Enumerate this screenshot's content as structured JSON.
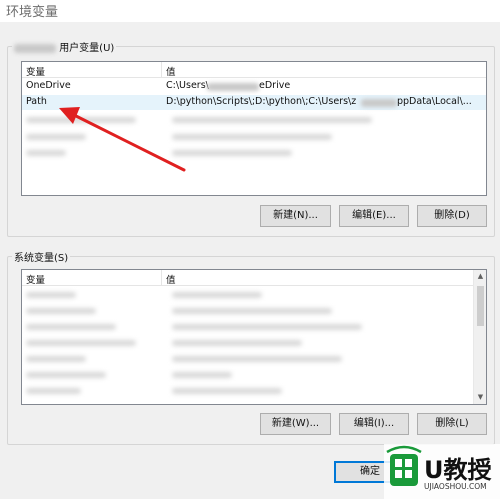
{
  "window": {
    "title": "环境变量"
  },
  "user_vars": {
    "group_label": "用户变量(U)",
    "col_name": "变量",
    "col_value": "值",
    "rows": [
      {
        "name": "OneDrive",
        "value_start": "C:\\Users\\",
        "value_end": "eDrive"
      },
      {
        "name": "Path",
        "value_start": "D:\\python\\Scripts\\;D:\\python\\;C:\\Users\\z",
        "value_end": "ppData\\Local\\..."
      }
    ],
    "buttons": {
      "new": "新建(N)...",
      "edit": "编辑(E)...",
      "delete": "删除(D)"
    }
  },
  "system_vars": {
    "group_label": "系统变量(S)",
    "col_name": "变量",
    "col_value": "值",
    "buttons": {
      "new": "新建(W)...",
      "edit": "编辑(I)...",
      "delete": "删除(L)"
    }
  },
  "footer": {
    "ok": "确定"
  },
  "watermark": {
    "brand": "U教授",
    "url": "UJIAOSHOU.COM"
  },
  "colors": {
    "arrow": "#e02020",
    "selection": "#e5f3fb",
    "watermark_green": "#1a9a3a"
  }
}
